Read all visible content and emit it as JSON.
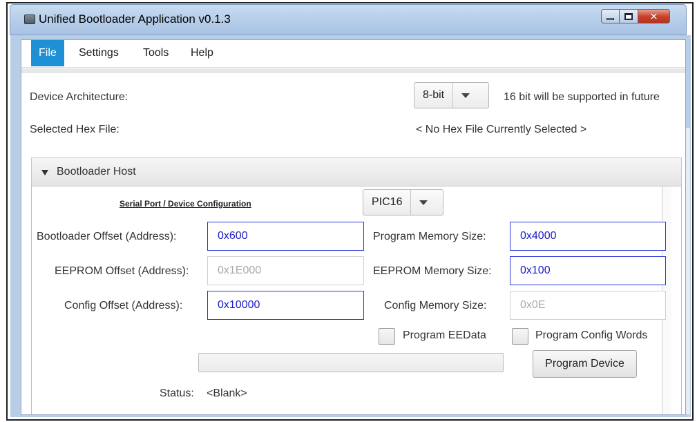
{
  "window": {
    "title": "Unified Bootloader Application v0.1.3"
  },
  "menu": {
    "items": [
      "File",
      "Settings",
      "Tools",
      "Help"
    ]
  },
  "device_architecture": {
    "label": "Device Architecture:",
    "value": "8-bit",
    "note": "16 bit will be supported in future"
  },
  "hex_file": {
    "label": "Selected Hex File:",
    "value": "< No Hex File Currently Selected >"
  },
  "panel": {
    "title": "Bootloader Host",
    "serial_config_label": "Serial Port / Device Configuration",
    "device_family": "PIC16",
    "bootloader_offset": {
      "label": "Bootloader Offset (Address):",
      "value": "0x600"
    },
    "eeprom_offset": {
      "label": "EEPROM Offset (Address):",
      "value": "0x1E000"
    },
    "config_offset": {
      "label": "Config Offset (Address):",
      "value": "0x10000"
    },
    "program_memory_size": {
      "label": "Program Memory Size:",
      "value": "0x4000"
    },
    "eeprom_memory_size": {
      "label": "EEPROM Memory Size:",
      "value": "0x100"
    },
    "config_memory_size": {
      "label": "Config Memory Size:",
      "value": "0x0E"
    },
    "program_eedata": "Program EEData",
    "program_config_words": "Program Config Words",
    "program_device": "Program Device",
    "status_label": "Status:",
    "status_value": "<Blank>"
  }
}
